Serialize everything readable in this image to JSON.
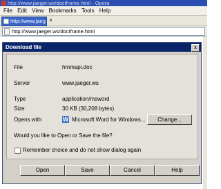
{
  "window": {
    "title": "http://www.jaeger.ws/docIframe.html - Opera"
  },
  "menu": [
    "File",
    "Edit",
    "View",
    "Bookmarks",
    "Tools",
    "Help"
  ],
  "tab": {
    "label": "http://www.jaeg..."
  },
  "address": {
    "url": "http://www.jaeger.ws/docIframe.html"
  },
  "dialog": {
    "title": "Download file",
    "close": "x",
    "fields": {
      "file_label": "File",
      "file_value": "hmmapi.doc",
      "server_label": "Server",
      "server_value": "www.jaeger.ws",
      "type_label": "Type",
      "type_value": "application/msword",
      "size_label": "Size",
      "size_value": "30 KB (30,208 bytes)",
      "opens_label": "Opens with",
      "opens_value": "Microsoft Word for Windows..."
    },
    "change_label": "Change...",
    "question": "Would you like to Open or Save the file?",
    "remember_label": "Remember choice and do not show dialog again",
    "buttons": {
      "open": "Open",
      "save": "Save",
      "cancel": "Cancel",
      "help": "Help"
    }
  }
}
